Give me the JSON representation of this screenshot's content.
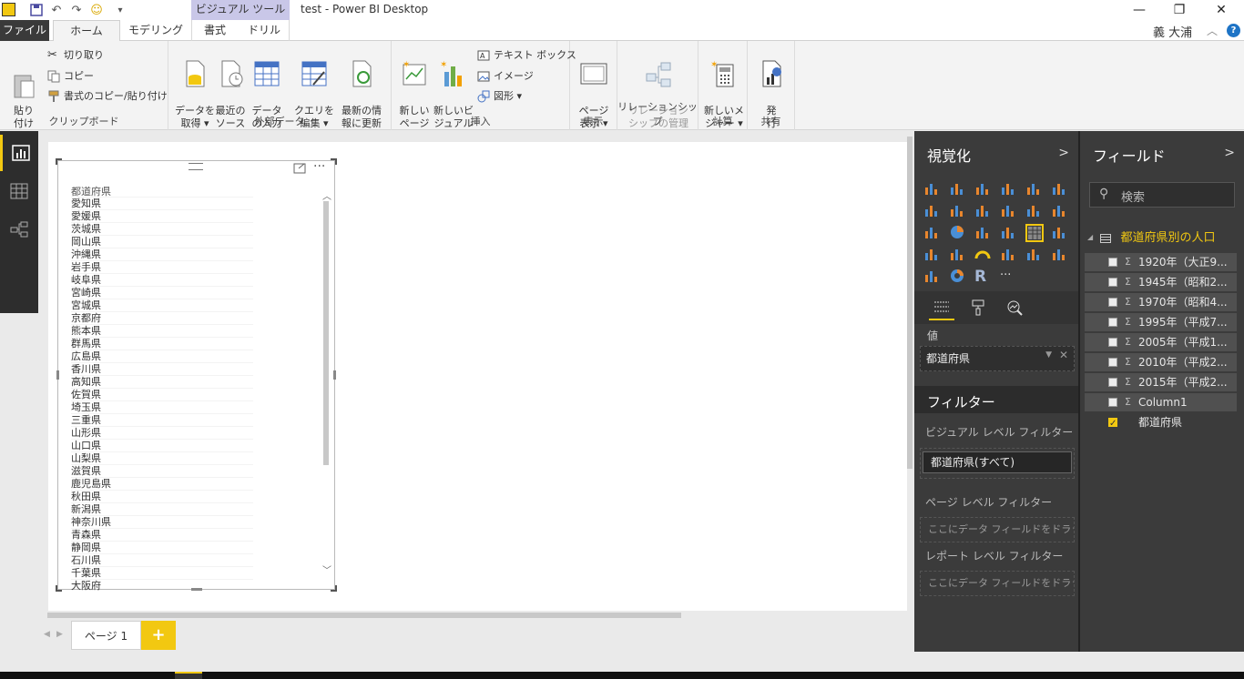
{
  "titlebar": {
    "context_tab": "ビジュアル ツール",
    "window_title": "test - Power BI Desktop",
    "minimize": "—",
    "restore": "❐",
    "close": "✕"
  },
  "tabs": {
    "file": "ファイル",
    "home": "ホーム",
    "modeling": "モデリング",
    "format": "書式",
    "drill": "ドリル",
    "user": "義 大浦",
    "help": "?"
  },
  "ribbon": {
    "clipboard": {
      "paste": "貼り\n付け",
      "cut": "切り取り",
      "copy": "コピー",
      "format_painter": "書式のコピー/貼り付け",
      "label": "クリップボード"
    },
    "external_data": {
      "get_data": "データを\n取得 ▾",
      "recent_sources": "最近の\nソース ▾",
      "enter_data": "データ\nの入力",
      "edit_queries": "クエリを\n編集 ▾",
      "refresh": "最新の情\n報に更新",
      "label": "外部データ"
    },
    "insert": {
      "new_page": "新しい\nページ ▾",
      "new_visual": "新しいビ\nジュアル",
      "textbox": "テキスト ボックス",
      "image": "イメージ",
      "shapes": "図形 ▾",
      "label": "挿入"
    },
    "view": {
      "page_view": "ページ\n表示 ▾",
      "label": "表示"
    },
    "relationships": {
      "manage": "リレーション\nシップの管理",
      "label": "リレーションシップ"
    },
    "calculations": {
      "new_measure": "新しいメ\nジャー ▾",
      "label": "計算"
    },
    "share": {
      "publish": "発\n行",
      "label": "共有"
    }
  },
  "visual": {
    "header": "都道府県",
    "rows": [
      "愛知県",
      "愛媛県",
      "茨城県",
      "岡山県",
      "沖縄県",
      "岩手県",
      "岐阜県",
      "宮崎県",
      "宮城県",
      "京都府",
      "熊本県",
      "群馬県",
      "広島県",
      "香川県",
      "高知県",
      "佐賀県",
      "埼玉県",
      "三重県",
      "山形県",
      "山口県",
      "山梨県",
      "滋賀県",
      "鹿児島県",
      "秋田県",
      "新潟県",
      "神奈川県",
      "青森県",
      "静岡県",
      "石川県",
      "千葉県",
      "大阪府"
    ]
  },
  "pages": {
    "page1": "ページ 1",
    "add": "+"
  },
  "visualizations": {
    "title": "視覚化",
    "values_label": "値",
    "values_field": "都道府県",
    "filters_title": "フィルター",
    "visual_level": "ビジュアル レベル フィルター",
    "visual_filter": "都道府県(すべて)",
    "page_level": "ページ レベル フィルター",
    "page_drop": "ここにデータ フィールドをドラッグ...",
    "report_level": "レポート レベル フィルター",
    "report_drop": "ここにデータ フィールドをドラッグ...",
    "r_icon": "R",
    "more_icon": "···"
  },
  "fields": {
    "title": "フィールド",
    "search_placeholder": "検索",
    "table_name": "都道府県別の人口",
    "items": [
      {
        "sigma": "Σ",
        "name": "1920年（大正9..."
      },
      {
        "sigma": "Σ",
        "name": "1945年（昭和2..."
      },
      {
        "sigma": "Σ",
        "name": "1970年（昭和4..."
      },
      {
        "sigma": "Σ",
        "name": "1995年（平成7..."
      },
      {
        "sigma": "Σ",
        "name": "2005年（平成1..."
      },
      {
        "sigma": "Σ",
        "name": "2010年（平成2..."
      },
      {
        "sigma": "Σ",
        "name": "2015年（平成2..."
      },
      {
        "sigma": "Σ",
        "name": "Column1"
      },
      {
        "sigma": "",
        "name": "都道府県"
      }
    ]
  },
  "colors": {
    "accent": "#f2c811",
    "pane": "#3b3b3b",
    "nav": "#2d2d2d",
    "context_tab": "#c9c7e8"
  }
}
